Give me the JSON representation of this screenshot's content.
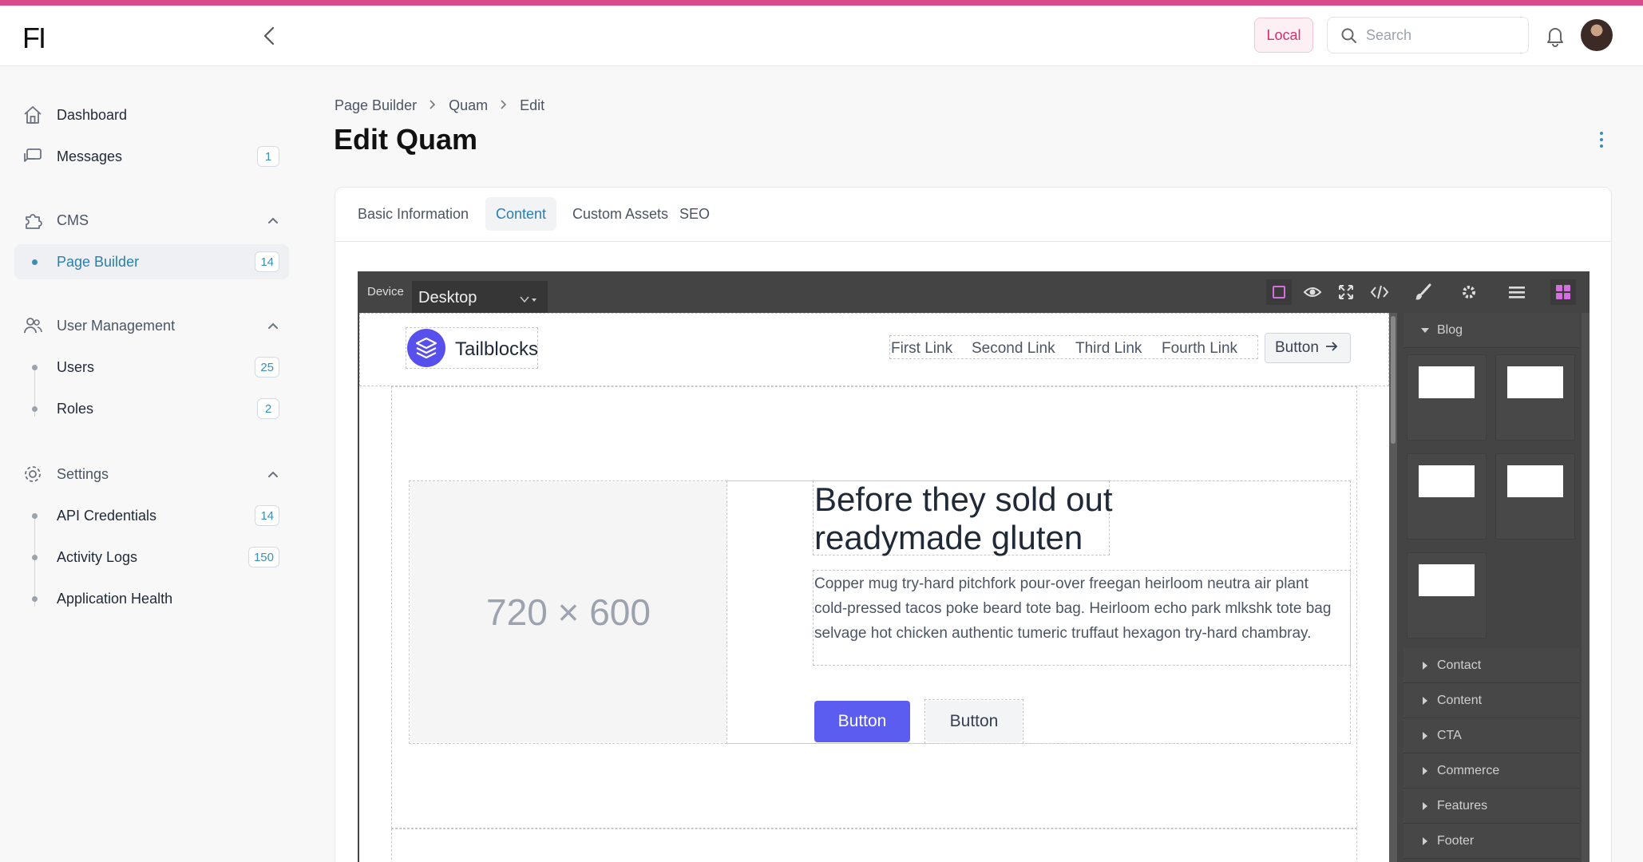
{
  "app": {
    "logo_text": "FI",
    "env_badge": "Local",
    "search_placeholder": "Search",
    "accent": "#d94b8c"
  },
  "sidebar": {
    "items": [
      {
        "label": "Dashboard",
        "icon": "home-icon"
      },
      {
        "label": "Messages",
        "icon": "chat-icon",
        "count": "1"
      }
    ],
    "groups": [
      {
        "label": "CMS",
        "icon": "puzzle-icon",
        "children": [
          {
            "label": "Page Builder",
            "count": "14",
            "active": true
          }
        ]
      },
      {
        "label": "User Management",
        "icon": "users-icon",
        "children": [
          {
            "label": "Users",
            "count": "25"
          },
          {
            "label": "Roles",
            "count": "2"
          }
        ]
      },
      {
        "label": "Settings",
        "icon": "gear-icon",
        "children": [
          {
            "label": "API Credentials",
            "count": "14"
          },
          {
            "label": "Activity Logs",
            "count": "150"
          },
          {
            "label": "Application Health"
          }
        ]
      }
    ]
  },
  "breadcrumb": [
    "Page Builder",
    "Quam",
    "Edit"
  ],
  "page_title": "Edit Quam",
  "tabs": [
    {
      "label": "Basic Information"
    },
    {
      "label": "Content",
      "active": true
    },
    {
      "label": "Custom Assets"
    },
    {
      "label": "SEO"
    }
  ],
  "editor": {
    "device_label": "Device",
    "device_value": "Desktop",
    "toolbar_icons": [
      "square-outline-icon",
      "eye-icon",
      "fullscreen-icon",
      "code-icon",
      "paint-brush-icon",
      "gear-icon",
      "layers-icon",
      "blocks-icon"
    ],
    "preview": {
      "brand": "Tailblocks",
      "nav_links": [
        "First Link",
        "Second Link",
        "Third Link",
        "Fourth Link"
      ],
      "nav_button": "Button",
      "placeholder": "720 × 600",
      "hero_title": "Before they sold out readymade gluten",
      "hero_desc": "Copper mug try-hard pitchfork pour-over freegan heirloom neutra air plant cold-pressed tacos poke beard tote bag. Heirloom echo park mlkshk tote bag selvage hot chicken authentic tumeric truffaut hexagon try-hard chambray.",
      "primary_button": "Button",
      "secondary_button": "Button",
      "brand_color": "#5b5df0"
    },
    "block_categories": [
      {
        "label": "Blog",
        "open": true
      },
      {
        "label": "Contact"
      },
      {
        "label": "Content"
      },
      {
        "label": "CTA"
      },
      {
        "label": "Commerce"
      },
      {
        "label": "Features"
      },
      {
        "label": "Footer"
      }
    ]
  }
}
